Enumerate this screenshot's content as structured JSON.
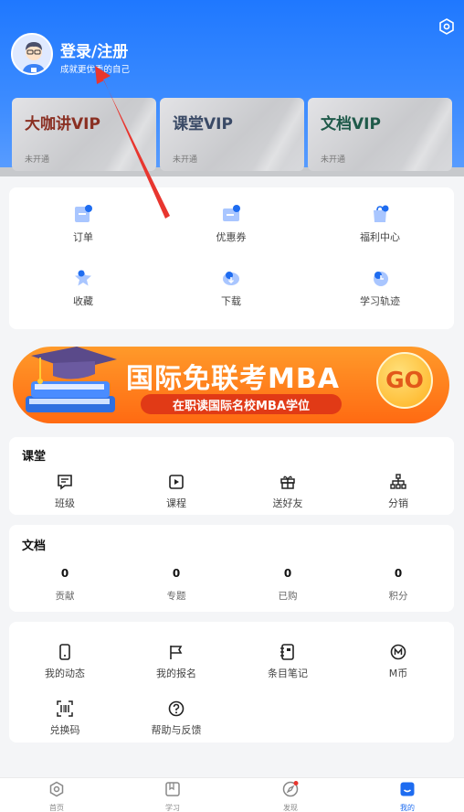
{
  "header": {
    "login_title": "登录/注册",
    "login_subtitle": "成就更优秀的自己",
    "settings_icon": "settings-hexagon-icon"
  },
  "vip_cards": [
    {
      "title": "大咖讲VIP",
      "status": "未开通",
      "color": "#8a2f22"
    },
    {
      "title": "课堂VIP",
      "status": "未开通",
      "color": "#3a4a66"
    },
    {
      "title": "文档VIP",
      "status": "未开通",
      "color": "#1f5a4a"
    }
  ],
  "quick_menu": [
    {
      "label": "订单",
      "icon": "order-icon"
    },
    {
      "label": "优惠券",
      "icon": "coupon-icon"
    },
    {
      "label": "福利中心",
      "icon": "gift-bag-icon"
    },
    {
      "label": "收藏",
      "icon": "star-icon"
    },
    {
      "label": "下载",
      "icon": "download-cloud-icon"
    },
    {
      "label": "学习轨迹",
      "icon": "clock-icon"
    }
  ],
  "banner": {
    "title": "国际免联考MBA",
    "subtitle": "在职读国际名校MBA学位",
    "button": "GO"
  },
  "classroom": {
    "title": "课堂",
    "items": [
      {
        "label": "班级",
        "icon": "class-icon"
      },
      {
        "label": "课程",
        "icon": "course-play-icon"
      },
      {
        "label": "送好友",
        "icon": "gift-icon"
      },
      {
        "label": "分销",
        "icon": "distribution-icon"
      }
    ]
  },
  "documents": {
    "title": "文档",
    "stats": [
      {
        "value": "0",
        "label": "贡献"
      },
      {
        "value": "0",
        "label": "专题"
      },
      {
        "value": "0",
        "label": "已购"
      },
      {
        "value": "0",
        "label": "积分"
      }
    ]
  },
  "more_menu": [
    {
      "label": "我的动态",
      "icon": "phone-icon"
    },
    {
      "label": "我的报名",
      "icon": "flag-icon"
    },
    {
      "label": "条目笔记",
      "icon": "notebook-icon"
    },
    {
      "label": "M币",
      "icon": "m-coin-icon"
    },
    {
      "label": "兑换码",
      "icon": "scan-code-icon"
    },
    {
      "label": "帮助与反馈",
      "icon": "help-icon"
    }
  ],
  "tabbar": [
    {
      "label": "首页",
      "icon": "home-icon"
    },
    {
      "label": "学习",
      "icon": "book-icon"
    },
    {
      "label": "发现",
      "icon": "compass-icon"
    },
    {
      "label": "我的",
      "icon": "profile-icon"
    }
  ],
  "colors": {
    "brand": "#1e6cf0",
    "banner_orange": "#ff7a1a",
    "arrow_red": "#e8362f"
  }
}
